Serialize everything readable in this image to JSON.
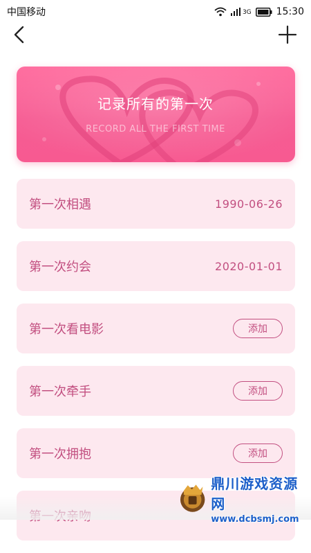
{
  "status_bar": {
    "carrier": "中国移动",
    "network": "3G",
    "time": "15:30"
  },
  "nav": {
    "back_icon": "chevron-left-icon",
    "add_icon": "plus-icon"
  },
  "banner": {
    "title": "记录所有的第一次",
    "subtitle": "RECORD ALL THE FIRST TIME",
    "accent_color": "#f65c93"
  },
  "items": [
    {
      "label": "第一次相遇",
      "date": "1990-06-26"
    },
    {
      "label": "第一次约会",
      "date": "2020-01-01"
    },
    {
      "label": "第一次看电影",
      "action": "添加"
    },
    {
      "label": "第一次牵手",
      "action": "添加"
    },
    {
      "label": "第一次拥抱",
      "action": "添加"
    },
    {
      "label": "第一次亲吻"
    }
  ],
  "watermark": {
    "title": "鼎川游戏资源网",
    "url": "www.dcbsmj.com"
  },
  "colors": {
    "item_background": "#fde8ef",
    "item_text": "#c24f80"
  }
}
